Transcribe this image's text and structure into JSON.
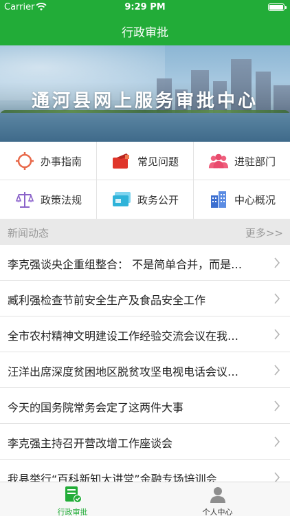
{
  "status_bar": {
    "carrier": "Carrier",
    "time": "9:29 PM"
  },
  "nav": {
    "title": "行政审批"
  },
  "banner": {
    "text": "通河县网上服务审批中心"
  },
  "grid": [
    {
      "label": "办事指南",
      "icon": "compass-icon",
      "color": "#e8694a"
    },
    {
      "label": "常见问题",
      "icon": "megaphone-icon",
      "color": "#e0362b"
    },
    {
      "label": "进驻部门",
      "icon": "group-icon",
      "color": "#ef5f7d"
    },
    {
      "label": "政策法规",
      "icon": "scales-icon",
      "color": "#8b63c9"
    },
    {
      "label": "政务公开",
      "icon": "card-icon",
      "color": "#2fb3d9"
    },
    {
      "label": "中心概况",
      "icon": "building-icon",
      "color": "#3c6fd0"
    }
  ],
  "news_header": {
    "title": "新闻动态",
    "more": "更多>>"
  },
  "news": [
    "李克强谈央企重组整合： 不是简单合并，而是…",
    "臧利强检查节前安全生产及食品安全工作",
    "全市农村精神文明建设工作经验交流会议在我…",
    "汪洋出席深度贫困地区脱贫攻坚电视电话会议…",
    "今天的国务院常务会定了这两件大事",
    "李克强主持召开营改增工作座谈会",
    "我县举行“百科新知大讲堂”金融专场培训会"
  ],
  "tabbar": [
    {
      "label": "行政审批",
      "icon": "approval-icon",
      "active": true
    },
    {
      "label": "个人中心",
      "icon": "person-icon",
      "active": false
    }
  ],
  "colors": {
    "brand": "#22ac38",
    "tab_inactive": "#333333"
  }
}
